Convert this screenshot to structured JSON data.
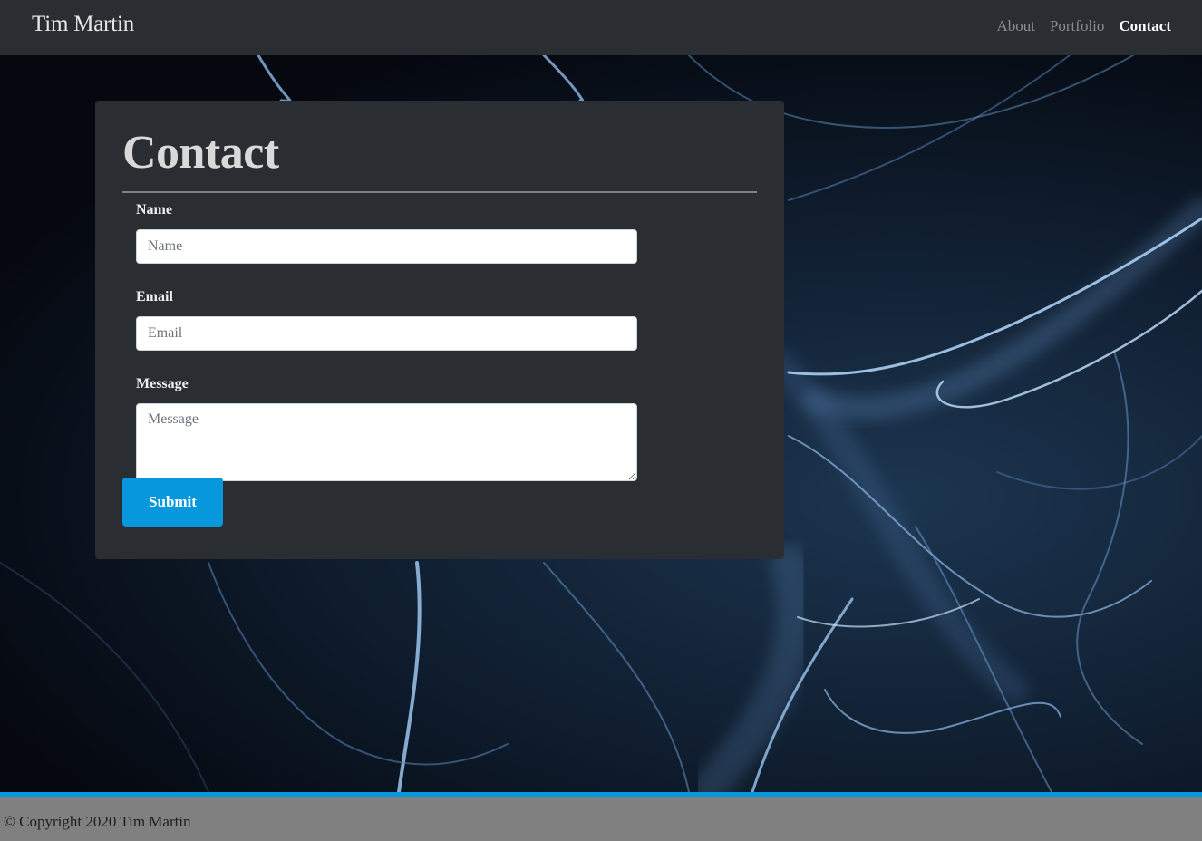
{
  "navbar": {
    "brand": "Tim Martin",
    "links": [
      {
        "label": "About",
        "active": false
      },
      {
        "label": "Portfolio",
        "active": false
      },
      {
        "label": "Contact",
        "active": true
      }
    ]
  },
  "contact": {
    "title": "Contact",
    "fields": {
      "name": {
        "label": "Name",
        "placeholder": "Name",
        "value": ""
      },
      "email": {
        "label": "Email",
        "placeholder": "Email",
        "value": ""
      },
      "message": {
        "label": "Message",
        "placeholder": "Message",
        "value": ""
      }
    },
    "submit_label": "Submit"
  },
  "footer": {
    "text": "© Copyright 2020 Tim Martin"
  },
  "colors": {
    "navbar_bg": "#2a2e33",
    "card_bg": "#2a2e33",
    "accent": "#0797dd",
    "footer_bg": "#808080"
  }
}
